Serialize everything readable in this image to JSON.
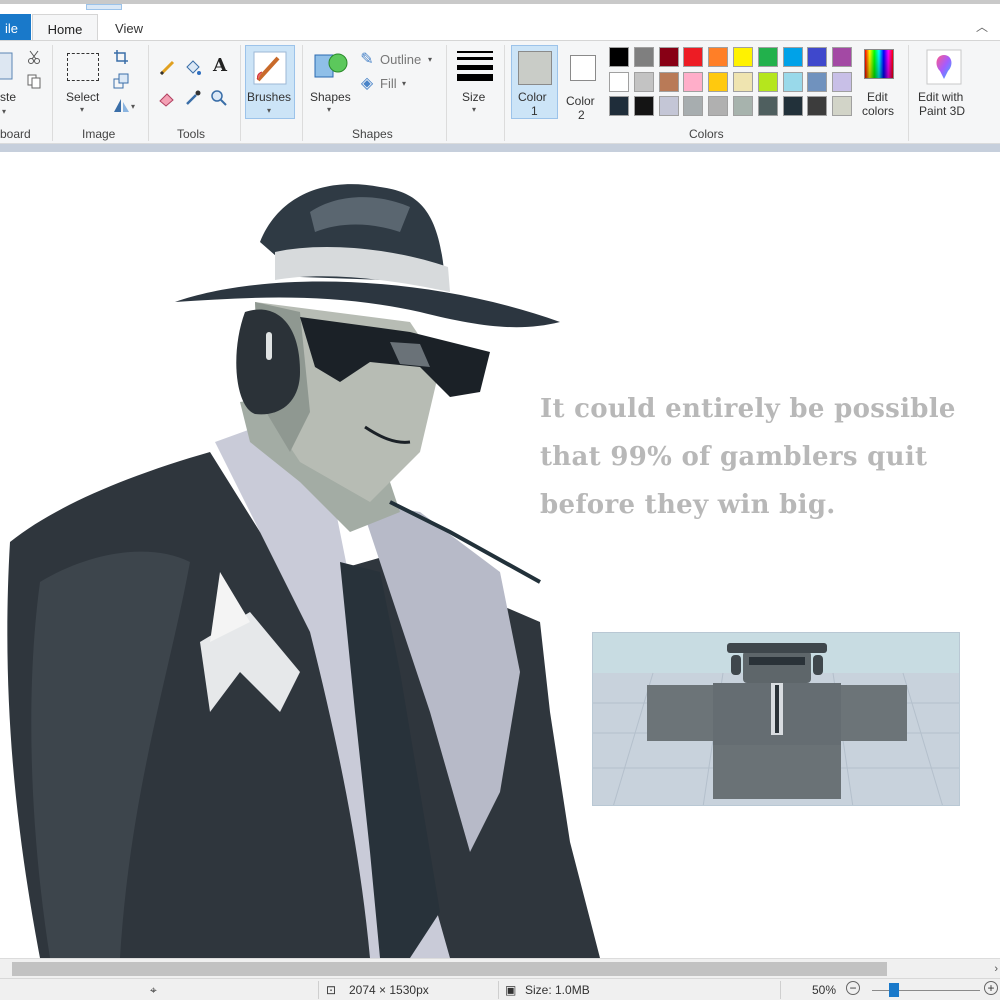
{
  "window": {
    "collapse_icon": "chevron-up-icon"
  },
  "tabs": {
    "file": "ile",
    "home": "Home",
    "view": "View"
  },
  "ribbon": {
    "clipboard": {
      "paste_label": "ste",
      "group_label": "board",
      "icons": [
        "paste-icon",
        "cut-icon",
        "copy-icon"
      ]
    },
    "image": {
      "select_label": "Select",
      "group_label": "Image",
      "icons": [
        "select-icon",
        "crop-icon",
        "resize-icon",
        "rotate-icon"
      ]
    },
    "tools": {
      "group_label": "Tools",
      "icons": [
        "pencil-icon",
        "fill-bucket-icon",
        "text-icon",
        "eraser-icon",
        "color-picker-icon",
        "magnifier-icon"
      ]
    },
    "brushes": {
      "label": "Brushes"
    },
    "shapes": {
      "shapes_label": "Shapes",
      "outline_label": "Outline",
      "fill_label": "Fill",
      "group_label": "Shapes"
    },
    "size": {
      "label": "Size"
    },
    "colors": {
      "color1_label": "Color",
      "color1_num": "1",
      "color2_label": "Color",
      "color2_num": "2",
      "color1_value": "#c9ccc7",
      "color2_value": "#ffffff",
      "palette": [
        [
          "#000000",
          "#7f7f7f",
          "#880015",
          "#ed1c24",
          "#ff7f27",
          "#fff200",
          "#22b14c",
          "#00a2e8",
          "#3f48cc",
          "#a349a4"
        ],
        [
          "#ffffff",
          "#c3c3c3",
          "#b97a57",
          "#ffaec9",
          "#ffc90e",
          "#efe4b0",
          "#b5e61d",
          "#99d9ea",
          "#7092be",
          "#c8bfe7"
        ],
        [
          "#1f2d3a",
          "#141414",
          "#c4c6d6",
          "#a7adaf",
          "#b0b0b0",
          "#a7b3ad",
          "#4f5f5f",
          "#22313a",
          "#3c3c3c",
          "#d2d4c8"
        ]
      ],
      "edit_colors_label_1": "Edit",
      "edit_colors_label_2": "colors",
      "group_label": "Colors"
    },
    "paint3d": {
      "label_1": "Edit with",
      "label_2": "Paint 3D"
    }
  },
  "canvas": {
    "quote_lines": [
      "It could entirely be possible",
      "that 99% of gamblers quit",
      "before they win big."
    ],
    "quote_color": "#b8b8b8"
  },
  "statusbar": {
    "dimensions": "2074 × 1530px",
    "size": "Size: 1.0MB",
    "zoom": "50%",
    "zoom_out": "−",
    "zoom_in": "+",
    "zoom_fraction": 0.2
  }
}
